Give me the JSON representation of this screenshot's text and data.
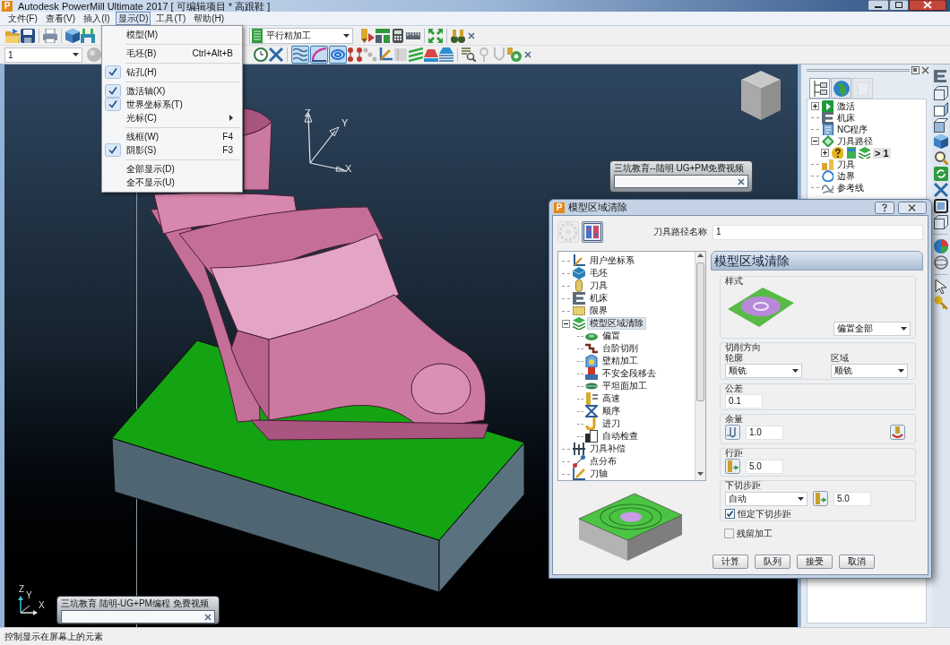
{
  "window": {
    "logo": "P",
    "title": "Autodesk PowerMill Ultimate 2017  [ 可编辑项目 * 高跟鞋 ]"
  },
  "menu_bar": [
    {
      "label": "文件(F)",
      "selected": false
    },
    {
      "label": "查看(V)",
      "selected": false
    },
    {
      "label": "插入(I)",
      "selected": false
    },
    {
      "label": "显示(D)",
      "selected": true
    },
    {
      "label": "工具(T)",
      "selected": false
    },
    {
      "label": "帮助(H)",
      "selected": false
    }
  ],
  "display_menu": [
    [
      {
        "label": "模型(M)",
        "checked": false
      }
    ],
    [
      {
        "label": "毛坯(B)",
        "shortcut": "Ctrl+Alt+B",
        "checked": false
      }
    ],
    [
      {
        "label": "钻孔(H)",
        "checked": true
      }
    ],
    [
      {
        "label": "激活轴(X)",
        "checked": true
      },
      {
        "label": "世界坐标系(T)",
        "checked": true
      },
      {
        "label": "光标(C)",
        "checked": false,
        "submenu": true
      }
    ],
    [
      {
        "label": "线框(W)",
        "shortcut": "F4",
        "checked": false
      },
      {
        "label": "阴影(S)",
        "shortcut": "F3",
        "checked": true
      }
    ],
    [
      {
        "label": "全部显示(D)",
        "checked": false
      },
      {
        "label": "全不显示(U)",
        "checked": false
      }
    ]
  ],
  "toolbar": {
    "strategy": "平行精加工",
    "toolpath": "1",
    "view_toggles": [
      {
        "on": true
      },
      {
        "on": true
      },
      {
        "on": true
      }
    ]
  },
  "viewport": {
    "triad_labels": [
      "Z",
      "Y",
      "X"
    ],
    "corner_triad_labels": [
      "Z",
      "Y",
      "X"
    ]
  },
  "floating_windows": [
    {
      "title": "三坑教育--陆明 UG+PM免费视频"
    },
    {
      "title": "三坑教育 陆明-UG+PM编程 免费视频"
    }
  ],
  "explorer": {
    "tabs": [
      {
        "selected": true,
        "disabled": false
      },
      {
        "selected": false,
        "disabled": false
      },
      {
        "selected": false,
        "disabled": true
      }
    ],
    "tree": [
      {
        "label": "激活",
        "selected": false,
        "expanded": false
      },
      {
        "label": "机床",
        "selected": false
      },
      {
        "label": "NC程序",
        "selected": false
      },
      {
        "label": "刀具路径",
        "selected": false,
        "expanded": true,
        "children": [
          {
            "label": "> 1",
            "selected": true,
            "expanded": false
          }
        ]
      },
      {
        "label": "刀具",
        "selected": false
      },
      {
        "label": "边界",
        "selected": false
      },
      {
        "label": "参考线",
        "selected": false
      }
    ]
  },
  "dialog": {
    "logo": "P",
    "title": "模型区域清除",
    "top_buttons": [
      {
        "disabled": true,
        "selected": false
      },
      {
        "disabled": false,
        "selected": true
      }
    ],
    "name_label": "刀具路径名称",
    "name_value": "1",
    "tree": [
      {
        "label": "用户坐标系",
        "selected": false
      },
      {
        "label": "毛坯",
        "selected": false
      },
      {
        "label": "刀具",
        "selected": false
      },
      {
        "label": "机床",
        "selected": false
      },
      {
        "label": "限界",
        "selected": false
      },
      {
        "label": "模型区域清除",
        "selected": true,
        "expanded": true,
        "children": [
          {
            "label": "偏置",
            "selected": false
          },
          {
            "label": "台阶切削",
            "selected": false
          },
          {
            "label": "壁精加工",
            "selected": false
          },
          {
            "label": "不安全段移去",
            "selected": false
          },
          {
            "label": "平坦面加工",
            "selected": false
          },
          {
            "label": "高速",
            "selected": false
          },
          {
            "label": "顺序",
            "selected": false
          },
          {
            "label": "进刀",
            "selected": false
          },
          {
            "label": "自动检查",
            "selected": false
          }
        ]
      },
      {
        "label": "刀具补偿",
        "selected": false
      },
      {
        "label": "点分布",
        "selected": false
      },
      {
        "label": "刀轴",
        "selected": false
      }
    ],
    "header": "模型区域清除",
    "style": {
      "label": "样式",
      "value": "偏置全部"
    },
    "cut_direction": {
      "label": "切削方向",
      "profile": {
        "label": "轮廓",
        "value": "顺铣"
      },
      "area": {
        "label": "区域",
        "value": "顺铣"
      }
    },
    "tolerance": {
      "label": "公差",
      "value": "0.1"
    },
    "thickness": {
      "label": "余量",
      "value": "1.0"
    },
    "stepover": {
      "label": "行距",
      "value": "5.0"
    },
    "stepdown": {
      "label": "下切步距",
      "mode": "自动",
      "value": "5.0",
      "constant": {
        "label": "恒定下切步距",
        "checked": true
      }
    },
    "rest_machining": {
      "label": "残留加工",
      "checked": false
    },
    "buttons": [
      "计算",
      "队列",
      "接受",
      "取消"
    ]
  },
  "status_bar": {
    "text": "控制显示在屏幕上的元素"
  }
}
